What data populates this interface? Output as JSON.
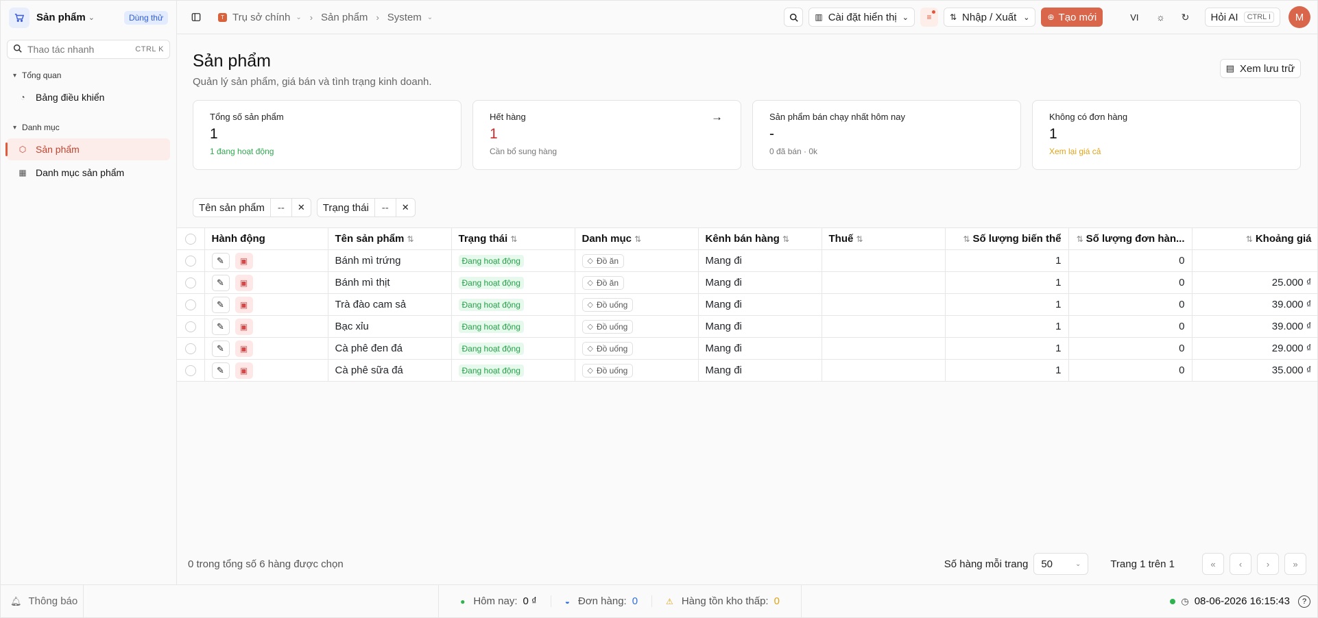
{
  "sidebar": {
    "title": "Sản phẩm",
    "trial_badge": "Dùng thử",
    "search_placeholder": "Thao tác nhanh",
    "search_shortcut": "CTRL K",
    "groups": [
      {
        "label": "Tổng quan",
        "items": [
          {
            "label": "Bảng điều khiển"
          }
        ]
      },
      {
        "label": "Danh mục",
        "items": [
          {
            "label": "Sản phẩm"
          },
          {
            "label": "Danh mục sản phẩm"
          }
        ]
      }
    ]
  },
  "topbar": {
    "breadcrumb": [
      "Trụ sở chính",
      "Sản phẩm",
      "System"
    ],
    "display_settings": "Cài đặt hiển thị",
    "import_export": "Nhập / Xuất",
    "create_new": "Tạo mới",
    "language": "VI",
    "ask_ai": "Hỏi AI",
    "ask_ai_shortcut": "CTRL I",
    "avatar_initial": "M"
  },
  "page": {
    "title": "Sản phẩm",
    "subtitle": "Quản lý sản phẩm, giá bán và tình trạng kinh doanh.",
    "archive_button": "Xem lưu trữ"
  },
  "cards": [
    {
      "label": "Tổng số sản phẩm",
      "value": "1",
      "note": "1 đang hoạt động"
    },
    {
      "label": "Hết hàng",
      "value": "1",
      "note": "Cần bổ sung hàng"
    },
    {
      "label": "Sản phẩm bán chạy nhất hôm nay",
      "value": "-",
      "note": "0 đã bán · 0k"
    },
    {
      "label": "Không có đơn hàng",
      "value": "1",
      "note": "Xem lại giá cả"
    }
  ],
  "filters": [
    {
      "label": "Tên sản phẩm",
      "value": "--"
    },
    {
      "label": "Trạng thái",
      "value": "--"
    }
  ],
  "table": {
    "headers": [
      "Hành động",
      "Tên sản phẩm",
      "Trạng thái",
      "Danh mục",
      "Kênh bán hàng",
      "Thuế",
      "Số lượng biến thể",
      "Số lượng đơn hàn...",
      "Khoảng giá"
    ],
    "rows": [
      {
        "name": "Bánh mì trứng",
        "status": "Đang hoạt động",
        "category": "Đồ ăn",
        "channel": "Mang đi",
        "tax": "",
        "variants": "1",
        "orders": "0",
        "price": ""
      },
      {
        "name": "Bánh mì thịt",
        "status": "Đang hoạt động",
        "category": "Đồ ăn",
        "channel": "Mang đi",
        "tax": "",
        "variants": "1",
        "orders": "0",
        "price": "25.000 ₫"
      },
      {
        "name": "Trà đào cam sả",
        "status": "Đang hoạt động",
        "category": "Đồ uống",
        "channel": "Mang đi",
        "tax": "",
        "variants": "1",
        "orders": "0",
        "price": "39.000 ₫"
      },
      {
        "name": "Bạc xỉu",
        "status": "Đang hoạt động",
        "category": "Đồ uống",
        "channel": "Mang đi",
        "tax": "",
        "variants": "1",
        "orders": "0",
        "price": "39.000 ₫"
      },
      {
        "name": "Cà phê đen đá",
        "status": "Đang hoạt động",
        "category": "Đồ uống",
        "channel": "Mang đi",
        "tax": "",
        "variants": "1",
        "orders": "0",
        "price": "29.000 ₫"
      },
      {
        "name": "Cà phê sữa đá",
        "status": "Đang hoạt động",
        "category": "Đồ uống",
        "channel": "Mang đi",
        "tax": "",
        "variants": "1",
        "orders": "0",
        "price": "35.000 ₫"
      }
    ]
  },
  "pager": {
    "selected_text": "0 trong tổng số 6 hàng được chọn",
    "rows_per_page_label": "Số hàng mỗi trang",
    "rows_per_page": "50",
    "page_info": "Trang 1 trên 1"
  },
  "footer": {
    "notifications": "Thông báo",
    "today_label": "Hôm nay:",
    "today_value": "0 ₫",
    "orders_label": "Đơn hàng:",
    "orders_value": "0",
    "low_stock_label": "Hàng tồn kho thấp:",
    "low_stock_value": "0",
    "datetime": "08-06-2026 16:15:43"
  },
  "colors": {
    "accent": "#d9654a",
    "success": "#24a148",
    "danger": "#cc2e2e",
    "warning": "#e0a31a"
  }
}
